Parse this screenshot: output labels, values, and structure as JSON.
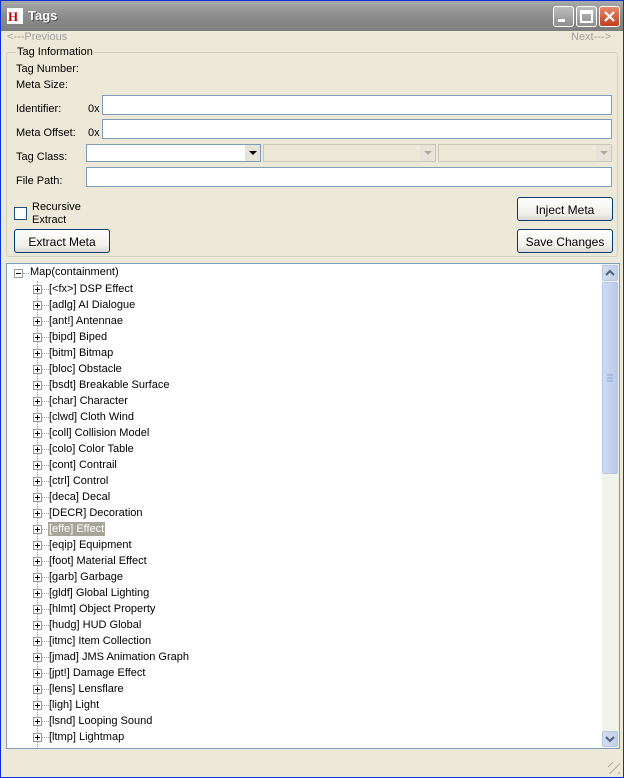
{
  "window": {
    "title": "Tags",
    "nav_previous": "<---Previous",
    "nav_next": "Next--->"
  },
  "tag_info": {
    "group_label": "Tag Information",
    "tag_number_label": "Tag Number:",
    "meta_size_label": "Meta Size:",
    "identifier_label": "Identifier:",
    "identifier_prefix": "0x",
    "identifier_value": "",
    "meta_offset_label": "Meta Offset:",
    "meta_offset_prefix": "0x",
    "meta_offset_value": "",
    "tag_class_label": "Tag Class:",
    "tag_class_value": "",
    "file_path_label": "File Path:",
    "file_path_value": ""
  },
  "controls": {
    "recursive_extract_line1": "Recursive",
    "recursive_extract_line2": "Extract",
    "recursive_checked": false,
    "extract_meta_label": "Extract Meta",
    "inject_meta_label": "Inject Meta",
    "save_changes_label": "Save Changes"
  },
  "tree": {
    "root_label": "Map(containment)",
    "selected_index": 15,
    "items": [
      "[<fx>] DSP Effect",
      "[adlg] AI Dialogue",
      "[ant!] Antennae",
      "[bipd] Biped",
      "[bitm] Bitmap",
      "[bloc] Obstacle",
      "[bsdt] Breakable Surface",
      "[char] Character",
      "[clwd] Cloth Wind",
      "[coll] Collision Model",
      "[colo] Color Table",
      "[cont] Contrail",
      "[ctrl] Control",
      "[deca] Decal",
      "[DECR] Decoration",
      "[effe] Effect",
      "[eqip] Equipment",
      "[foot] Material Effect",
      "[garb] Garbage",
      "[gldf] Global Lighting",
      "[hlmt] Object Property",
      "[hudg] HUD Global",
      "[itmc] Item Collection",
      "[jmad] JMS Animation Graph",
      "[jpt!] Damage Effect",
      "[lens] Lensflare",
      "[ligh] Light",
      "[lsnd] Looping Sound",
      "[ltmp] Lightmap"
    ]
  }
}
